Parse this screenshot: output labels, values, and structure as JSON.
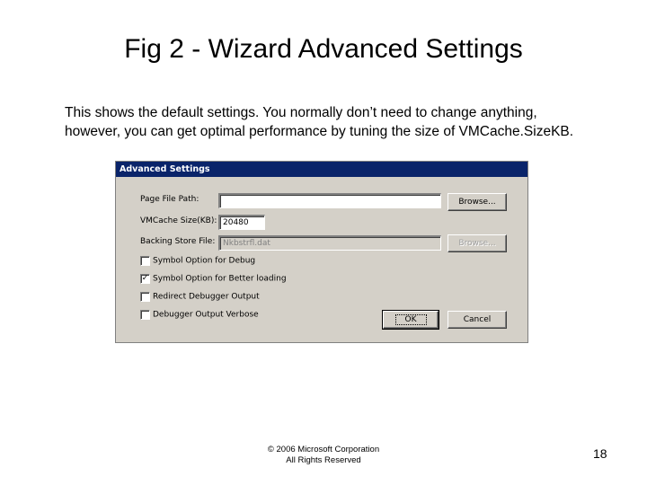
{
  "slide": {
    "title": "Fig 2 - Wizard Advanced Settings",
    "description": [
      "This shows the default settings. You normally don’t need to change anything,",
      "however, you can get optimal performance by tuning the size of VMCache.SizeKB."
    ]
  },
  "dialog": {
    "title": "Advanced Settings",
    "page_file_path": {
      "label": "Page File Path:",
      "value": ""
    },
    "vm_cache_size": {
      "label": "VMCache Size(KB):",
      "value": "20480"
    },
    "backing_store_file": {
      "label": "Backing Store File:",
      "value": "Nkbstrfl.dat"
    },
    "browse_label": "Browse...",
    "checkboxes": [
      {
        "label": "Symbol Option for Debug",
        "checked": false,
        "mark": ""
      },
      {
        "label": "Symbol Option for Better loading",
        "checked": true,
        "mark": "✓"
      },
      {
        "label": "Redirect Debugger Output",
        "checked": false,
        "mark": ""
      },
      {
        "label": "Debugger Output Verbose",
        "checked": false,
        "mark": ""
      }
    ],
    "ok_label": "OK",
    "cancel_label": "Cancel"
  },
  "footer": {
    "copyright": "© 2006 Microsoft Corporation",
    "rights": "All Rights Reserved",
    "page_number": "18"
  }
}
